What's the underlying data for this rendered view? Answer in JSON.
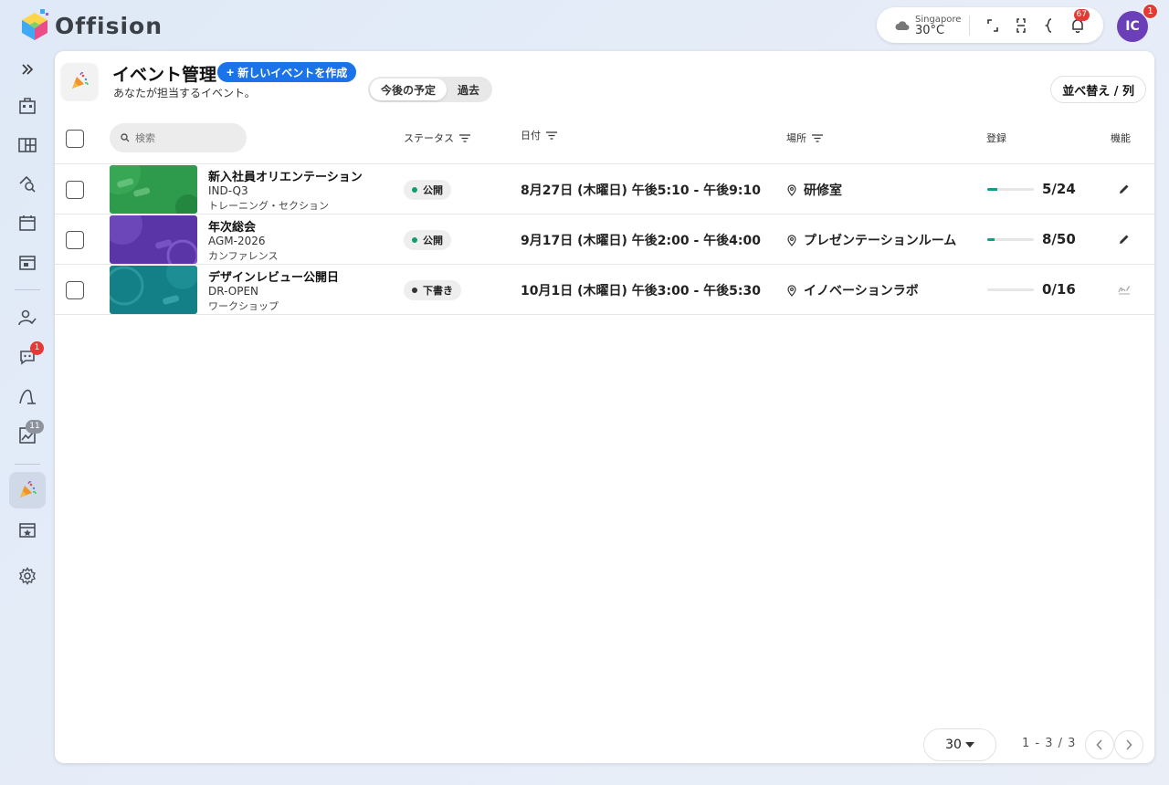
{
  "app": {
    "name": "Offision"
  },
  "topbar": {
    "weather": {
      "city": "Singapore",
      "temp": "30°C"
    },
    "notifications_count": "67",
    "avatar": {
      "initials": "IC",
      "badge": "1"
    }
  },
  "sidebar": {
    "badges": {
      "support": "1",
      "gallery": "11"
    }
  },
  "header": {
    "title": "イベント管理",
    "new_button": "新しいイベントを作成",
    "subtitle": "あなたが担当するイベント。",
    "tabs": [
      "今後の予定",
      "過去"
    ],
    "sort_button": "並べ替え / 列"
  },
  "table": {
    "search_placeholder": "検索",
    "columns": {
      "status": "ステータス",
      "date": "日付",
      "location": "場所",
      "registration": "登録",
      "actions": "機能"
    },
    "rows": [
      {
        "title": "新入社員オリエンテーション",
        "code": "IND-Q3",
        "category": "トレーニング・セクション",
        "status": "公開",
        "status_color": "#109e6e",
        "date": "8月27日 (木曜日) 午後5:10 - 午後9:10",
        "location": "研修室",
        "registration": "5/24",
        "fill": 0.21
      },
      {
        "title": "年次総会",
        "code": "AGM-2026",
        "category": "カンファレンス",
        "status": "公開",
        "status_color": "#109e6e",
        "date": "9月17日 (木曜日) 午後2:00 - 午後4:00",
        "location": "プレゼンテーションルーム",
        "registration": "8/50",
        "fill": 0.16
      },
      {
        "title": "デザインレビュー公開日",
        "code": "DR-OPEN",
        "category": "ワークショップ",
        "status": "下書き",
        "status_color": "#333333",
        "date": "10月1日 (木曜日) 午後3:00 - 午後5:30",
        "location": "イノベーションラボ",
        "registration": "0/16",
        "fill": 0
      }
    ]
  },
  "footer": {
    "per_page": "30",
    "range": "1 - 3 / 3"
  }
}
